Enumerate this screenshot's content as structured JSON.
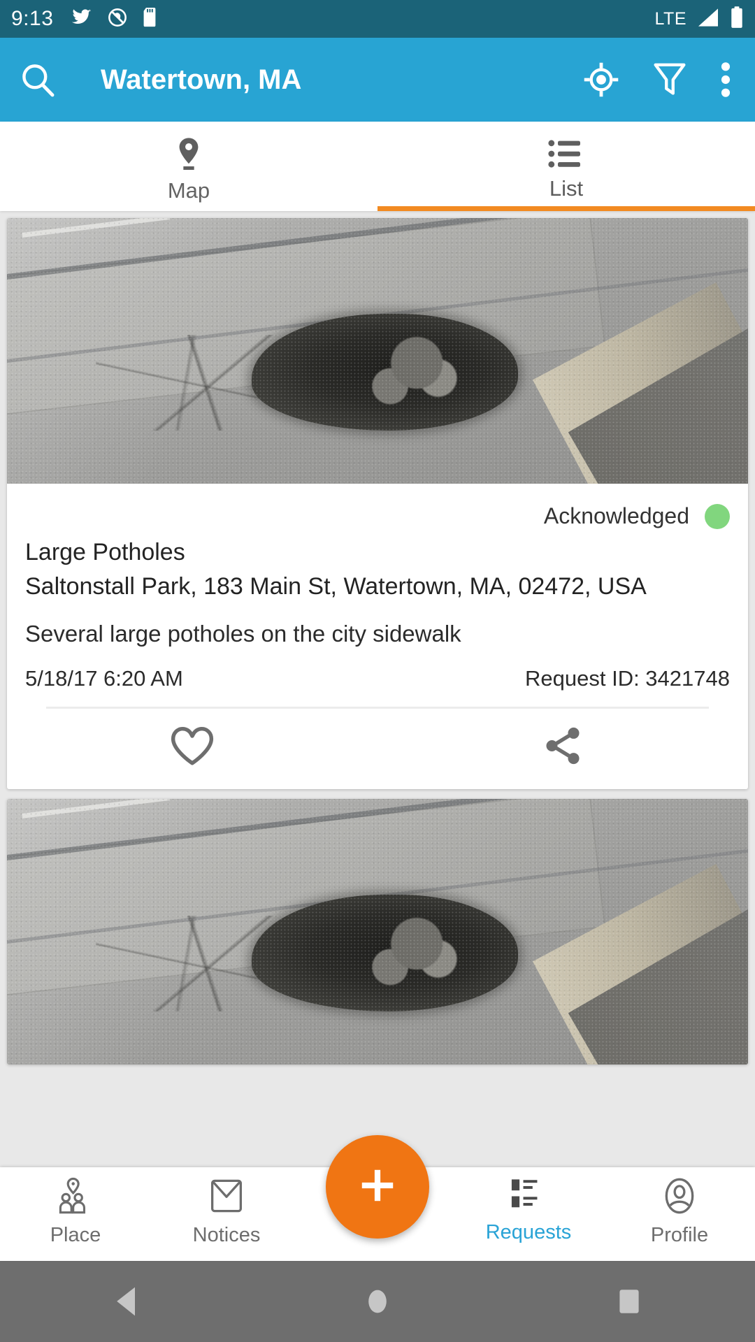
{
  "status_bar": {
    "time": "9:13",
    "icons": [
      "twitter-bird-icon",
      "do-not-disturb-icon",
      "sd-card-icon"
    ],
    "network": "LTE",
    "signal_icon": "signal-bars-icon",
    "battery_icon": "battery-full-icon"
  },
  "app_bar": {
    "background": "#28a4d3",
    "search_icon": "search-icon",
    "title": "Watertown, MA",
    "my_location_icon": "my-location-icon",
    "filter_icon": "filter-icon",
    "overflow_icon": "more-vertical-icon"
  },
  "tabs": {
    "active_index": 1,
    "indicator_color": "#f28a21",
    "items": [
      {
        "label": "Map",
        "icon": "map-pin-icon"
      },
      {
        "label": "List",
        "icon": "list-bullets-icon"
      }
    ]
  },
  "feed": {
    "cards": [
      {
        "photo_alt": "pothole-photo",
        "status": "Acknowledged",
        "status_color": "#81d67e",
        "title": "Large Potholes",
        "address": "Saltonstall Park, 183 Main St, Watertown, MA, 02472, USA",
        "description": "Several large potholes on the city sidewalk",
        "timestamp": "5/18/17 6:20 AM",
        "request_id": "Request ID: 3421748",
        "actions": [
          {
            "icon": "heart-icon"
          },
          {
            "icon": "share-icon"
          }
        ]
      },
      {
        "photo_alt": "pothole-photo"
      }
    ]
  },
  "bottom_nav": {
    "active": "Requests",
    "active_color": "#29a3d6",
    "fab": {
      "icon": "plus-icon",
      "color": "#f07513"
    },
    "items": [
      {
        "label": "Place",
        "icon": "place-people-icon"
      },
      {
        "label": "Notices",
        "icon": "envelope-icon"
      },
      {
        "label": "Requests",
        "icon": "requests-list-icon"
      },
      {
        "label": "Profile",
        "icon": "profile-person-icon"
      }
    ]
  },
  "android_nav": {
    "background": "#6e6e6e",
    "buttons": [
      {
        "icon": "back-triangle-icon"
      },
      {
        "icon": "home-circle-icon"
      },
      {
        "icon": "recents-square-icon"
      }
    ]
  }
}
